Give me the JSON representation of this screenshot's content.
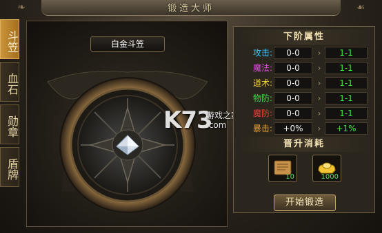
{
  "window": {
    "title": "锻造大师"
  },
  "tabs": [
    {
      "label": "斗笠",
      "active": true
    },
    {
      "label": "血石",
      "active": false
    },
    {
      "label": "勋章",
      "active": false
    },
    {
      "label": "盾牌",
      "active": false
    }
  ],
  "item": {
    "name": "白金斗笠"
  },
  "attributes": {
    "header": "下阶属性",
    "rows": [
      {
        "label": "攻击:",
        "label_color": "#36c6ff",
        "current": "0-0",
        "next": "1-1"
      },
      {
        "label": "魔法:",
        "label_color": "#e34ce6",
        "current": "0-0",
        "next": "1-1"
      },
      {
        "label": "道术:",
        "label_color": "#f2d33a",
        "current": "0-0",
        "next": "1-1"
      },
      {
        "label": "物防:",
        "label_color": "#42d94b",
        "current": "0-0",
        "next": "1-1"
      },
      {
        "label": "魔防:",
        "label_color": "#e8403a",
        "current": "0-0",
        "next": "1-1"
      },
      {
        "label": "暴击:",
        "label_color": "#e6a23a",
        "current": "+0%",
        "next": "+1%"
      }
    ]
  },
  "cost": {
    "header": "晋升消耗",
    "items": [
      {
        "icon": "scroll-icon",
        "count": "10"
      },
      {
        "icon": "gold-ingot-icon",
        "count": "1000"
      }
    ]
  },
  "actions": {
    "forge_label": "开始锻造"
  },
  "watermark": {
    "logo": "K73",
    "text": "游戏之家",
    "domain": ".com"
  }
}
